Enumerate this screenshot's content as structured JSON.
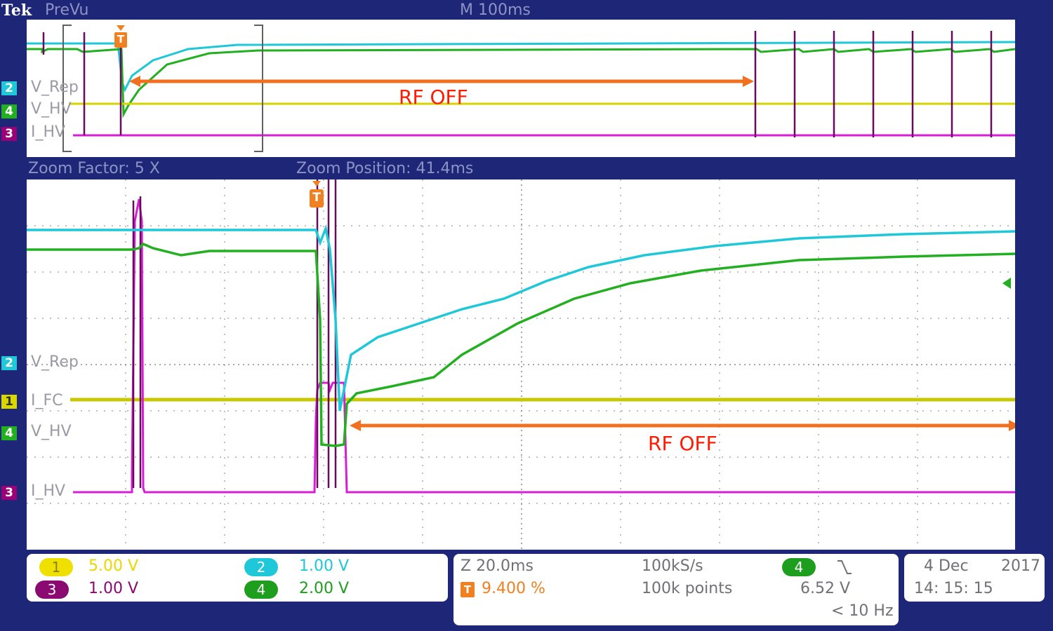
{
  "header": {
    "brand": "Tek",
    "mode": "PreVu",
    "timebase": "M 100ms"
  },
  "zoom": {
    "factor": "Zoom Factor: 5 X",
    "position": "Zoom Position: 41.4ms"
  },
  "channels": {
    "top": [
      {
        "num": "2",
        "label": "V_Rep",
        "color": "#1ec8d8"
      },
      {
        "num": "4",
        "label": "V_HV",
        "color": "#22b020"
      },
      {
        "num": "3",
        "label": "I_HV",
        "color": "#9a0078"
      }
    ],
    "main": [
      {
        "num": "2",
        "label": "V_Rep",
        "color": "#1ec8d8"
      },
      {
        "num": "1",
        "label": "I_FC",
        "color": "#d8d800"
      },
      {
        "num": "4",
        "label": "V_HV",
        "color": "#22b020"
      },
      {
        "num": "3",
        "label": "I_HV",
        "color": "#9a0078"
      }
    ]
  },
  "trigger_marker": "T",
  "annotations": {
    "top": "RF OFF",
    "main": "RF OFF"
  },
  "scales": {
    "ch1": {
      "num": "1",
      "value": "5.00 V",
      "color": "#f0e000"
    },
    "ch2": {
      "num": "2",
      "value": "1.00 V",
      "color": "#1ec8d8"
    },
    "ch3": {
      "num": "3",
      "value": "1.00 V",
      "color": "#8b0a72"
    },
    "ch4": {
      "num": "4",
      "value": "2.00 V",
      "color": "#1e9e1e"
    }
  },
  "acq": {
    "zoom_time": "Z 20.0ms",
    "trigger_pos": "9.400 %",
    "sample_rate": "100kS/s",
    "record_length": "100k points",
    "trigger_channel": "4",
    "trigger_level": "6.52 V",
    "trigger_freq": "< 10 Hz"
  },
  "datetime": {
    "date": "4 Dec",
    "year": "2017",
    "time": "14: 15: 15"
  }
}
